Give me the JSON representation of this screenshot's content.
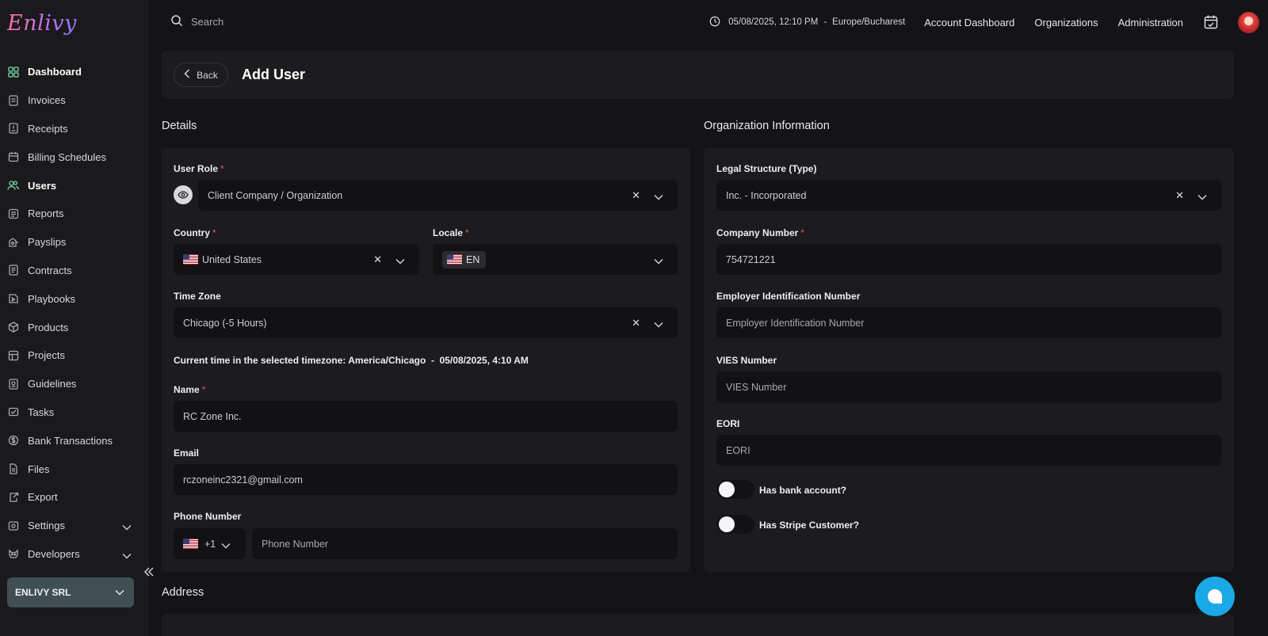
{
  "brand": {
    "logo_text": "Enlivy"
  },
  "sidebar": {
    "items": [
      {
        "label": "Dashboard",
        "icon": "grid-icon"
      },
      {
        "label": "Invoices",
        "icon": "invoice-icon"
      },
      {
        "label": "Receipts",
        "icon": "receipt-icon"
      },
      {
        "label": "Billing Schedules",
        "icon": "calendar-icon"
      },
      {
        "label": "Users",
        "icon": "users-icon"
      },
      {
        "label": "Reports",
        "icon": "report-icon"
      },
      {
        "label": "Payslips",
        "icon": "payslip-icon"
      },
      {
        "label": "Contracts",
        "icon": "contract-icon"
      },
      {
        "label": "Playbooks",
        "icon": "playbook-icon"
      },
      {
        "label": "Products",
        "icon": "box-icon"
      },
      {
        "label": "Projects",
        "icon": "project-icon"
      },
      {
        "label": "Guidelines",
        "icon": "guideline-icon"
      },
      {
        "label": "Tasks",
        "icon": "task-icon"
      },
      {
        "label": "Bank Transactions",
        "icon": "bank-icon"
      },
      {
        "label": "Files",
        "icon": "file-icon"
      },
      {
        "label": "Export",
        "icon": "export-icon"
      },
      {
        "label": "Settings",
        "icon": "gear-icon"
      },
      {
        "label": "Developers",
        "icon": "developer-icon"
      }
    ],
    "org_name": "ENLIVY SRL"
  },
  "topbar": {
    "search_placeholder": "Search",
    "datetime": "05/08/2025, 12:10 PM",
    "separator": "-",
    "timezone": "Europe/Bucharest",
    "links": [
      "Account Dashboard",
      "Organizations",
      "Administration"
    ]
  },
  "header": {
    "back_label": "Back",
    "title": "Add User"
  },
  "details": {
    "section_title": "Details",
    "user_role": {
      "label": "User Role",
      "value": "Client Company / Organization"
    },
    "country": {
      "label": "Country",
      "value": "United States"
    },
    "locale": {
      "label": "Locale",
      "value": "EN"
    },
    "time_zone": {
      "label": "Time Zone",
      "value": "Chicago (-5 Hours)"
    },
    "current_time_line": "Current time in the selected timezone: America/Chicago  -  05/08/2025, 4:10 AM",
    "name": {
      "label": "Name",
      "value": "RC Zone Inc."
    },
    "email": {
      "label": "Email",
      "value": "rczoneinc2321@gmail.com"
    },
    "phone": {
      "label": "Phone Number",
      "dial_code": "+1",
      "placeholder": "Phone Number"
    }
  },
  "organization": {
    "section_title": "Organization Information",
    "legal_structure": {
      "label": "Legal Structure (Type)",
      "value": "Inc. - Incorporated"
    },
    "company_number": {
      "label": "Company Number",
      "value": "754721221"
    },
    "ein": {
      "label": "Employer Identification Number",
      "placeholder": "Employer Identification Number"
    },
    "vies": {
      "label": "VIES Number",
      "placeholder": "VIES Number"
    },
    "eori": {
      "label": "EORI",
      "placeholder": "EORI"
    },
    "has_bank_account": {
      "label": "Has bank account?",
      "on": false
    },
    "has_stripe_customer": {
      "label": "Has Stripe Customer?",
      "on": false
    }
  },
  "address": {
    "section_title": "Address"
  },
  "required_mark": "*",
  "colors": {
    "accent_green": "#7ad9a6",
    "chat_blue": "#1aa8e6",
    "required_red": "#e05a5a"
  }
}
